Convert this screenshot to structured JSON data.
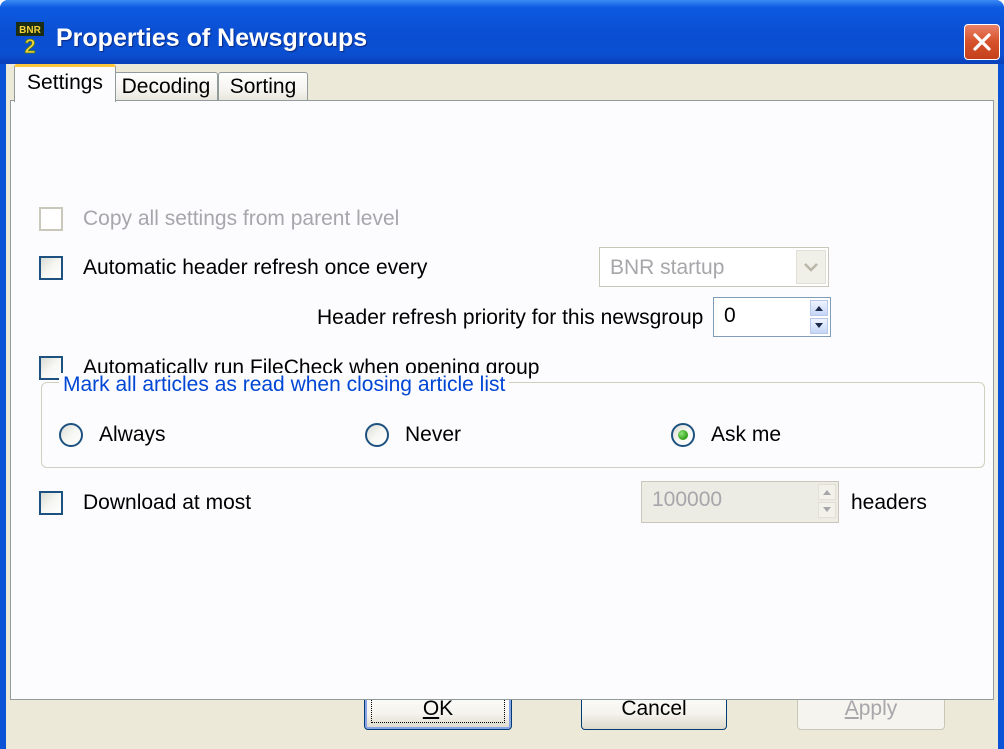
{
  "window": {
    "title": "Properties of Newsgroups",
    "app_icon": "bnr2-app-icon",
    "app_icon_text_top": "BNR",
    "app_icon_text_bottom": "2",
    "close_icon": "close-icon"
  },
  "tabs": [
    {
      "label": "Settings",
      "active": true
    },
    {
      "label": "Decoding",
      "active": false
    },
    {
      "label": "Sorting",
      "active": false
    }
  ],
  "settings": {
    "copy_parent": {
      "label": "Copy all settings from parent level",
      "checked": false,
      "enabled": false
    },
    "auto_refresh": {
      "label": "Automatic header refresh once every",
      "checked": false,
      "enabled": true
    },
    "refresh_interval": {
      "value": "BNR startup",
      "enabled": false
    },
    "priority": {
      "label": "Header refresh priority for this newsgroup",
      "value": "0"
    },
    "filecheck": {
      "label": "Automatically run FileCheck when opening group",
      "checked": false
    },
    "mark_read_group": {
      "legend": "Mark all articles as read when closing article list",
      "options": [
        {
          "label": "Always",
          "selected": false
        },
        {
          "label": "Never",
          "selected": false
        },
        {
          "label": "Ask me",
          "selected": true
        }
      ]
    },
    "download_at_most": {
      "label": "Download at most",
      "checked": false,
      "value": "100000",
      "suffix": "headers",
      "enabled": false
    }
  },
  "buttons": {
    "ok": {
      "label": "OK",
      "underline": "O",
      "rest": "K"
    },
    "cancel": {
      "label": "Cancel"
    },
    "apply": {
      "label": "Apply",
      "underline": "A",
      "rest": "pply",
      "enabled": false
    }
  },
  "colors": {
    "titlebar": "#0a4fd4",
    "dialog_face": "#ece9d8",
    "group_legend": "#0046d5",
    "close_button": "#d8542e",
    "radio_selected": "#3aa820"
  }
}
